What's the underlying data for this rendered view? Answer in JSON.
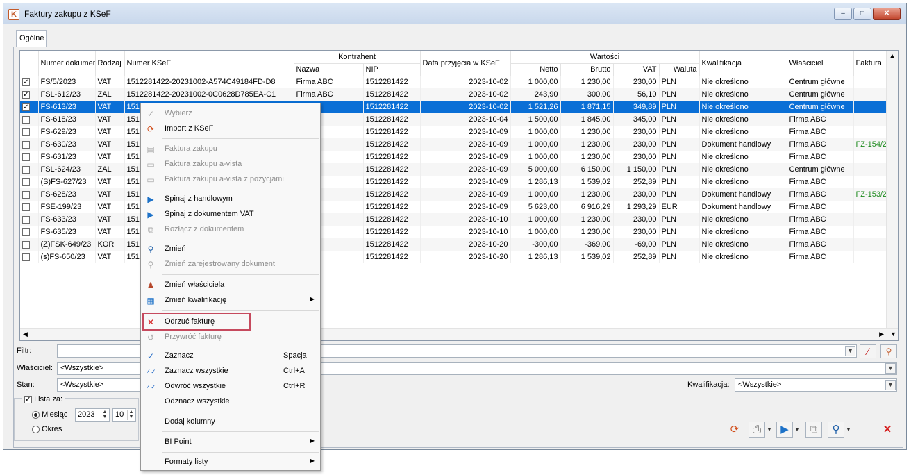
{
  "window": {
    "title": "Faktury zakupu z KSeF",
    "buttons": {
      "min": "–",
      "max": "□",
      "close": "✕"
    }
  },
  "tab": {
    "label": "Ogólne"
  },
  "grid": {
    "group_kontrahent": "Kontrahent",
    "group_wartosci": "Wartości",
    "columns": {
      "numer": "Numer dokumentu",
      "rodzaj": "Rodzaj",
      "ksef": "Numer KSeF",
      "nazwa": "Nazwa",
      "nip": "NIP",
      "data": "Data przyjęcia w KSeF",
      "netto": "Netto",
      "brutto": "Brutto",
      "vat": "VAT",
      "waluta": "Waluta",
      "kwal": "Kwalifikacja",
      "wlasc": "Właściciel",
      "faktura": "Faktura"
    },
    "rows": [
      {
        "chk": "✓",
        "numer": "FS/5/2023",
        "rodzaj": "VAT",
        "ksef": "1512281422-20231002-A574C49184FD-D8",
        "nazwa": "Firma ABC",
        "nip": "1512281422",
        "data": "2023-10-02",
        "netto": "1 000,00",
        "brutto": "1 230,00",
        "vat": "230,00",
        "waluta": "PLN",
        "kwal": "Nie określono",
        "wlasc": "Centrum główne",
        "faktura": ""
      },
      {
        "chk": "✓",
        "numer": "FSL-612/23",
        "rodzaj": "ZAL",
        "ksef": "1512281422-20231002-0C0628D785EA-C1",
        "nazwa": "Firma ABC",
        "nip": "1512281422",
        "data": "2023-10-02",
        "netto": "243,90",
        "brutto": "300,00",
        "vat": "56,10",
        "waluta": "PLN",
        "kwal": "Nie określono",
        "wlasc": "Centrum główne",
        "faktura": ""
      },
      {
        "chk": "✓",
        "numer": "FS-613/23",
        "rodzaj": "VAT",
        "ksef": "1512",
        "nazwa": "ABC",
        "nip": "1512281422",
        "data": "2023-10-02",
        "netto": "1 521,26",
        "brutto": "1 871,15",
        "vat": "349,89",
        "waluta": "PLN",
        "kwal": "Nie określono",
        "wlasc": "Centrum główne",
        "faktura": ""
      },
      {
        "chk": "",
        "numer": "FS-618/23",
        "rodzaj": "VAT",
        "ksef": "1512",
        "nazwa": "ABC",
        "nip": "1512281422",
        "data": "2023-10-04",
        "netto": "1 500,00",
        "brutto": "1 845,00",
        "vat": "345,00",
        "waluta": "PLN",
        "kwal": "Nie określono",
        "wlasc": "Firma ABC",
        "faktura": ""
      },
      {
        "chk": "",
        "numer": "FS-629/23",
        "rodzaj": "VAT",
        "ksef": "1512",
        "nazwa": "ABC",
        "nip": "1512281422",
        "data": "2023-10-09",
        "netto": "1 000,00",
        "brutto": "1 230,00",
        "vat": "230,00",
        "waluta": "PLN",
        "kwal": "Nie określono",
        "wlasc": "Firma ABC",
        "faktura": ""
      },
      {
        "chk": "",
        "numer": "FS-630/23",
        "rodzaj": "VAT",
        "ksef": "1512",
        "nazwa": "ABC",
        "nip": "1512281422",
        "data": "2023-10-09",
        "netto": "1 000,00",
        "brutto": "1 230,00",
        "vat": "230,00",
        "waluta": "PLN",
        "kwal": "Dokument handlowy",
        "wlasc": "Firma ABC",
        "faktura": "FZ-154/2"
      },
      {
        "chk": "",
        "numer": "FS-631/23",
        "rodzaj": "VAT",
        "ksef": "1512",
        "nazwa": "ABC",
        "nip": "1512281422",
        "data": "2023-10-09",
        "netto": "1 000,00",
        "brutto": "1 230,00",
        "vat": "230,00",
        "waluta": "PLN",
        "kwal": "Nie określono",
        "wlasc": "Firma ABC",
        "faktura": ""
      },
      {
        "chk": "",
        "numer": "FSL-624/23",
        "rodzaj": "ZAL",
        "ksef": "1512",
        "nazwa": "ABC",
        "nip": "1512281422",
        "data": "2023-10-09",
        "netto": "5 000,00",
        "brutto": "6 150,00",
        "vat": "1 150,00",
        "waluta": "PLN",
        "kwal": "Nie określono",
        "wlasc": "Centrum główne",
        "faktura": ""
      },
      {
        "chk": "",
        "numer": "(S)FS-627/23",
        "rodzaj": "VAT",
        "ksef": "1512",
        "nazwa": "ABC",
        "nip": "1512281422",
        "data": "2023-10-09",
        "netto": "1 286,13",
        "brutto": "1 539,02",
        "vat": "252,89",
        "waluta": "PLN",
        "kwal": "Nie określono",
        "wlasc": "Firma ABC",
        "faktura": ""
      },
      {
        "chk": "",
        "numer": "FS-628/23",
        "rodzaj": "VAT",
        "ksef": "1512",
        "nazwa": "ABC",
        "nip": "1512281422",
        "data": "2023-10-09",
        "netto": "1 000,00",
        "brutto": "1 230,00",
        "vat": "230,00",
        "waluta": "PLN",
        "kwal": "Dokument handlowy",
        "wlasc": "Firma ABC",
        "faktura": "FZ-153/2"
      },
      {
        "chk": "",
        "numer": "FSE-199/23",
        "rodzaj": "VAT",
        "ksef": "1512",
        "nazwa": "ABC",
        "nip": "1512281422",
        "data": "2023-10-09",
        "netto": "5 623,00",
        "brutto": "6 916,29",
        "vat": "1 293,29",
        "waluta": "EUR",
        "kwal": "Dokument handlowy",
        "wlasc": "Firma ABC",
        "faktura": ""
      },
      {
        "chk": "",
        "numer": "FS-633/23",
        "rodzaj": "VAT",
        "ksef": "1512",
        "nazwa": "ABC",
        "nip": "1512281422",
        "data": "2023-10-10",
        "netto": "1 000,00",
        "brutto": "1 230,00",
        "vat": "230,00",
        "waluta": "PLN",
        "kwal": "Nie określono",
        "wlasc": "Firma ABC",
        "faktura": ""
      },
      {
        "chk": "",
        "numer": "FS-635/23",
        "rodzaj": "VAT",
        "ksef": "1512",
        "nazwa": "ABC",
        "nip": "1512281422",
        "data": "2023-10-10",
        "netto": "1 000,00",
        "brutto": "1 230,00",
        "vat": "230,00",
        "waluta": "PLN",
        "kwal": "Nie określono",
        "wlasc": "Firma ABC",
        "faktura": ""
      },
      {
        "chk": "",
        "numer": "(Z)FSK-649/23",
        "rodzaj": "KOR",
        "ksef": "1512",
        "nazwa": "ABC",
        "nip": "1512281422",
        "data": "2023-10-20",
        "netto": "-300,00",
        "brutto": "-369,00",
        "vat": "-69,00",
        "waluta": "PLN",
        "kwal": "Nie określono",
        "wlasc": "Firma ABC",
        "faktura": ""
      },
      {
        "chk": "",
        "numer": "(s)FS-650/23",
        "rodzaj": "VAT",
        "ksef": "1512",
        "nazwa": "ABC",
        "nip": "1512281422",
        "data": "2023-10-20",
        "netto": "1 286,13",
        "brutto": "1 539,02",
        "vat": "252,89",
        "waluta": "PLN",
        "kwal": "Nie określono",
        "wlasc": "Firma ABC",
        "faktura": ""
      }
    ],
    "selected_row": 2
  },
  "filters": {
    "filtr_label": "Filtr:",
    "wlasciciel_label": "Właściciel:",
    "wlasciciel_value": "<Wszystkie>",
    "stan_label": "Stan:",
    "stan_value": "<Wszystkie>",
    "kwalifikacja_label": "Kwalifikacja:",
    "kwalifikacja_value": "<Wszystkie>",
    "lista_za": "Lista za:",
    "miesiac": "Miesiąc",
    "okres": "Okres",
    "rok": "2023",
    "mies": "10"
  },
  "context_menu": {
    "items": [
      {
        "label": "Wybierz",
        "icon": "check-icon",
        "disabled": true
      },
      {
        "label": "Import z KSeF",
        "icon": "import-icon",
        "disabled": false
      },
      {
        "label": "Faktura zakupu",
        "icon": "invoice-icon",
        "disabled": true
      },
      {
        "label": "Faktura zakupu a-vista",
        "icon": "vat-icon",
        "disabled": true
      },
      {
        "label": "Faktura zakupu a-vista z pozycjami",
        "icon": "vat-icon",
        "disabled": true
      },
      {
        "label": "Spinaj z handlowym",
        "icon": "link-icon",
        "disabled": false
      },
      {
        "label": "Spinaj z dokumentem VAT",
        "icon": "link-icon",
        "disabled": false
      },
      {
        "label": "Rozłącz z dokumentem",
        "icon": "unlink-icon",
        "disabled": true
      },
      {
        "label": "Zmień",
        "icon": "magnifier-icon",
        "disabled": false
      },
      {
        "label": "Zmień zarejestrowany dokument",
        "icon": "magnifier-icon",
        "disabled": true
      },
      {
        "label": "Zmień właściciela",
        "icon": "users-icon",
        "disabled": false
      },
      {
        "label": "Zmień kwalifikację",
        "icon": "qualify-icon",
        "disabled": false
      },
      {
        "label": "Odrzuć fakturę",
        "icon": "reject-icon",
        "disabled": false
      },
      {
        "label": "Przywróć fakturę",
        "icon": "restore-icon",
        "disabled": true
      },
      {
        "label": "Zaznacz",
        "icon": "check-icon",
        "disabled": false,
        "shortcut": "Spacja"
      },
      {
        "label": "Zaznacz wszystkie",
        "icon": "double-check-icon",
        "disabled": false,
        "shortcut": "Ctrl+A"
      },
      {
        "label": "Odwróć wszystkie",
        "icon": "invert-check-icon",
        "disabled": false,
        "shortcut": "Ctrl+R"
      },
      {
        "label": "Odznacz wszystkie",
        "icon": "",
        "disabled": false
      },
      {
        "label": "Dodaj kolumny",
        "icon": "",
        "disabled": false
      },
      {
        "label": "BI Point",
        "icon": "",
        "disabled": false
      },
      {
        "label": "Formaty listy",
        "icon": "",
        "disabled": false
      }
    ]
  },
  "colors": {
    "selection": "#0a6fd6",
    "highlight_box": "#c64a5e",
    "faktura_link": "#1d8a1d"
  }
}
